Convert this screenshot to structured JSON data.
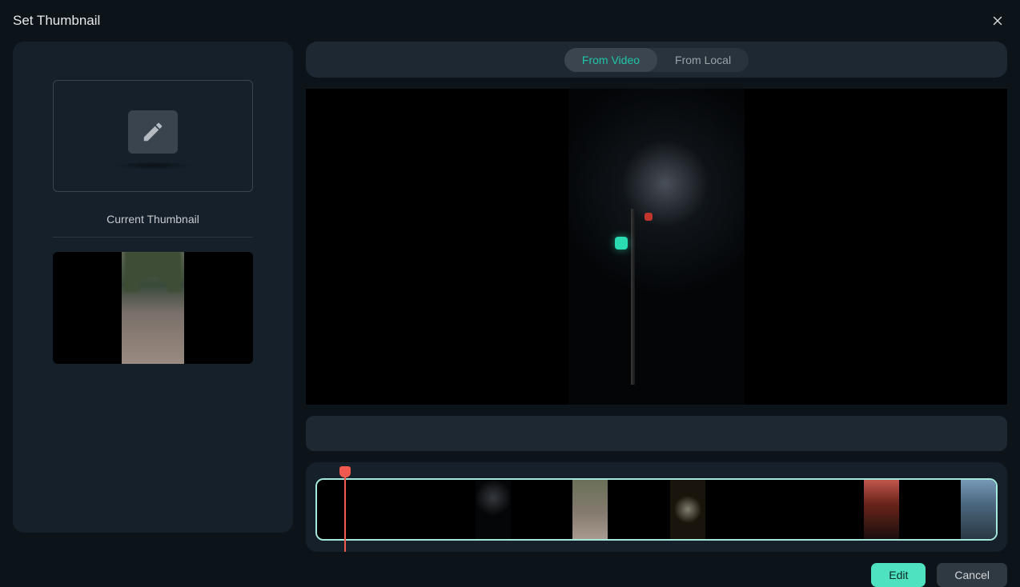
{
  "dialog": {
    "title": "Set Thumbnail"
  },
  "leftPanel": {
    "currentThumbnailLabel": "Current Thumbnail"
  },
  "tabs": {
    "fromVideo": "From Video",
    "fromLocal": "From Local"
  },
  "buttons": {
    "edit": "Edit",
    "cancel": "Cancel"
  }
}
